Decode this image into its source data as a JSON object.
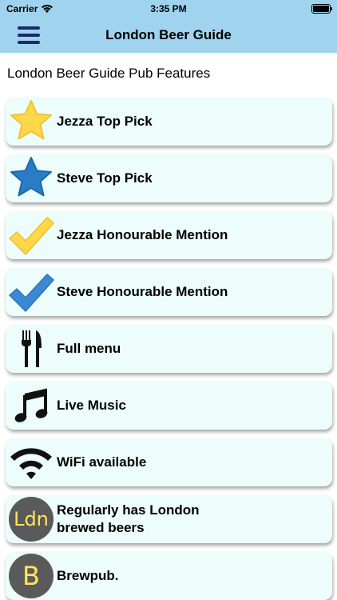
{
  "status": {
    "carrier": "Carrier",
    "time": "3:35 PM"
  },
  "nav": {
    "title": "London Beer Guide"
  },
  "page": {
    "section_title": "London Beer Guide Pub Features"
  },
  "features": [
    {
      "label": "Jezza Top Pick",
      "icon": "yellow-star-icon"
    },
    {
      "label": "Steve Top Pick",
      "icon": "blue-star-icon"
    },
    {
      "label": "Jezza Honourable Mention",
      "icon": "yellow-check-icon"
    },
    {
      "label": "Steve Honourable Mention",
      "icon": "blue-check-icon"
    },
    {
      "label": "Full menu",
      "icon": "fork-knife-icon"
    },
    {
      "label": "Live Music",
      "icon": "music-note-icon"
    },
    {
      "label": "WiFi available",
      "icon": "wifi-icon"
    },
    {
      "label": "Regularly has London brewed beers",
      "icon": "ldn-badge-icon",
      "badge_text": "Ldn"
    },
    {
      "label": "Brewpub.",
      "icon": "brewpub-badge-icon",
      "badge_text": "B"
    }
  ],
  "colors": {
    "bar": "#9fd3ee",
    "row_bg": "#ecfdfb",
    "accent_navy": "#1a2b6d",
    "star_yellow": "#ffd84a",
    "star_blue": "#2a7cc7"
  }
}
